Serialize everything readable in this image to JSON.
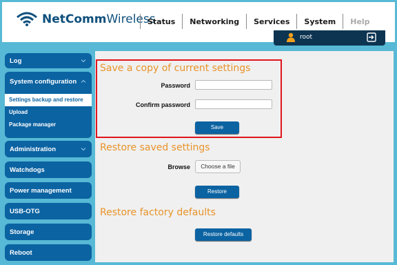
{
  "brand": {
    "name_bold": "NetComm",
    "name_light": "Wireless"
  },
  "nav": [
    "Status",
    "Networking",
    "Services",
    "System",
    "Help"
  ],
  "user": {
    "name": "root"
  },
  "sidebar": {
    "log": "Log",
    "system_configuration": "System configuration",
    "sub_items": [
      "Settings backup and restore",
      "Upload",
      "Package manager"
    ],
    "administration": "Administration",
    "watchdogs": "Watchdogs",
    "power_management": "Power management",
    "usb_otg": "USB-OTG",
    "storage": "Storage",
    "reboot": "Reboot"
  },
  "save_section": {
    "title": "Save a copy of current settings",
    "password_label": "Password",
    "confirm_label": "Confirm password",
    "save_button": "Save"
  },
  "restore_section": {
    "title": "Restore saved settings",
    "browse_label": "Browse",
    "choose_file": "Choose a file",
    "restore_button": "Restore"
  },
  "factory_section": {
    "title": "Restore factory defaults",
    "restore_defaults_button": "Restore defaults"
  },
  "colors": {
    "accent": "#0b63a2",
    "title": "#e8932a",
    "highlight": "#e0141c",
    "header_dark": "#0d3552"
  }
}
